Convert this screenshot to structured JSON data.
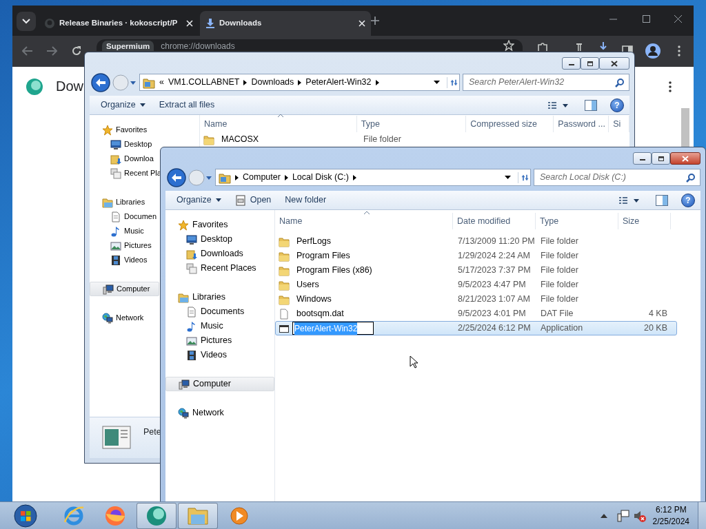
{
  "browser": {
    "tabs": [
      {
        "title": "Release Binaries · kokoscript/P",
        "kind": "github",
        "selected": false
      },
      {
        "title": "Downloads",
        "kind": "download",
        "selected": true
      }
    ],
    "site_chip": "Supermium",
    "url": "chrome://downloads",
    "page_heading": "Dow"
  },
  "back_window": {
    "active": false,
    "breadcrumb": [
      {
        "label": "«",
        "kind": "overflow"
      },
      {
        "label": "VM1.COLLABNET",
        "kind": "folder"
      },
      {
        "label": "Downloads",
        "kind": "folder"
      },
      {
        "label": "PeterAlert-Win32",
        "kind": "folder"
      }
    ],
    "search_placeholder": "Search PeterAlert-Win32",
    "toolbar": [
      {
        "label": "Organize",
        "kind": "menu"
      },
      {
        "label": "Extract all files",
        "kind": "plain"
      }
    ],
    "help": "?",
    "sidebar": [
      {
        "label": "Favorites",
        "kind": "favorites",
        "selected": false,
        "children": [
          {
            "label": "Desktop",
            "kind": "desktop",
            "selected": false
          },
          {
            "label": "Downloa",
            "kind": "downloads",
            "selected": false
          },
          {
            "label": "Recent Pla",
            "kind": "recent",
            "selected": false
          }
        ]
      },
      {
        "label": "Libraries",
        "kind": "libraries",
        "selected": false,
        "children": [
          {
            "label": "Documen",
            "kind": "documents",
            "selected": false
          },
          {
            "label": "Music",
            "kind": "music",
            "selected": false
          },
          {
            "label": "Pictures",
            "kind": "pictures",
            "selected": false
          },
          {
            "label": "Videos",
            "kind": "videos",
            "selected": false
          }
        ]
      },
      {
        "label": "Computer",
        "kind": "computer",
        "selected": true
      },
      {
        "label": "Network",
        "kind": "network",
        "selected": false
      }
    ],
    "columns": [
      {
        "label": "Name",
        "sorted": true
      },
      {
        "label": "Type",
        "sorted": false
      },
      {
        "label": "Compressed size",
        "sorted": false
      },
      {
        "label": "Password ...",
        "sorted": false
      },
      {
        "label": "Si",
        "sorted": false
      }
    ],
    "rows": [
      {
        "name": "MACOSX",
        "type": "File folder",
        "kind": "folder"
      }
    ],
    "details_name": "Pete"
  },
  "front_window": {
    "active": true,
    "breadcrumb": [
      {
        "label": "Computer",
        "kind": "folder"
      },
      {
        "label": "Local Disk (C:)",
        "kind": "folder"
      }
    ],
    "search_placeholder": "Search Local Disk (C:)",
    "toolbar": [
      {
        "label": "Organize",
        "kind": "menu"
      },
      {
        "label": "Open",
        "kind": "open"
      },
      {
        "label": "New folder",
        "kind": "plain"
      }
    ],
    "help": "?",
    "sidebar": [
      {
        "label": "Favorites",
        "kind": "favorites",
        "selected": false,
        "children": [
          {
            "label": "Desktop",
            "kind": "desktop",
            "selected": false
          },
          {
            "label": "Downloads",
            "kind": "downloads",
            "selected": false
          },
          {
            "label": "Recent Places",
            "kind": "recent",
            "selected": false
          }
        ]
      },
      {
        "label": "Libraries",
        "kind": "libraries",
        "selected": false,
        "children": [
          {
            "label": "Documents",
            "kind": "documents",
            "selected": false
          },
          {
            "label": "Music",
            "kind": "music",
            "selected": false
          },
          {
            "label": "Pictures",
            "kind": "pictures",
            "selected": false
          },
          {
            "label": "Videos",
            "kind": "videos",
            "selected": false
          }
        ]
      },
      {
        "label": "Computer",
        "kind": "computer",
        "selected": true
      },
      {
        "label": "Network",
        "kind": "network",
        "selected": false
      }
    ],
    "columns": [
      {
        "label": "Name",
        "sorted": true
      },
      {
        "label": "Date modified",
        "sorted": false
      },
      {
        "label": "Type",
        "sorted": false
      },
      {
        "label": "Size",
        "sorted": false
      }
    ],
    "rows": [
      {
        "name": "PerfLogs",
        "date": "7/13/2009 11:20 PM",
        "type": "File folder",
        "size": "",
        "kind": "folder",
        "selected": false,
        "editing": false
      },
      {
        "name": "Program Files",
        "date": "1/29/2024 2:24 AM",
        "type": "File folder",
        "kind": "folder",
        "selected": false,
        "editing": false
      },
      {
        "name": "Program Files (x86)",
        "date": "5/17/2023 7:37 PM",
        "type": "File folder",
        "kind": "folder",
        "selected": false,
        "editing": false
      },
      {
        "name": "Users",
        "date": "9/5/2023 4:47 PM",
        "type": "File folder",
        "kind": "folder",
        "selected": false,
        "editing": false
      },
      {
        "name": "Windows",
        "date": "8/21/2023 1:07 AM",
        "type": "File folder",
        "kind": "folder",
        "selected": false,
        "editing": false
      },
      {
        "name": "bootsqm.dat",
        "date": "9/5/2023 4:01 PM",
        "type": "DAT File",
        "size": "4 KB",
        "kind": "file",
        "selected": false,
        "editing": false
      },
      {
        "name": "PeterAlert-Win32",
        "date": "2/25/2024 6:12 PM",
        "type": "Application",
        "size": "20 KB",
        "kind": "app",
        "selected": true,
        "editing": true
      }
    ]
  },
  "taskbar": {
    "items": [
      {
        "kind": "start",
        "selected": false
      },
      {
        "kind": "ie",
        "selected": false
      },
      {
        "kind": "firefox",
        "selected": false
      },
      {
        "kind": "supermium",
        "selected": true
      },
      {
        "kind": "explorer",
        "selected": true
      },
      {
        "kind": "media",
        "selected": false
      }
    ],
    "time": "6:12 PM",
    "date": "2/25/2024"
  }
}
